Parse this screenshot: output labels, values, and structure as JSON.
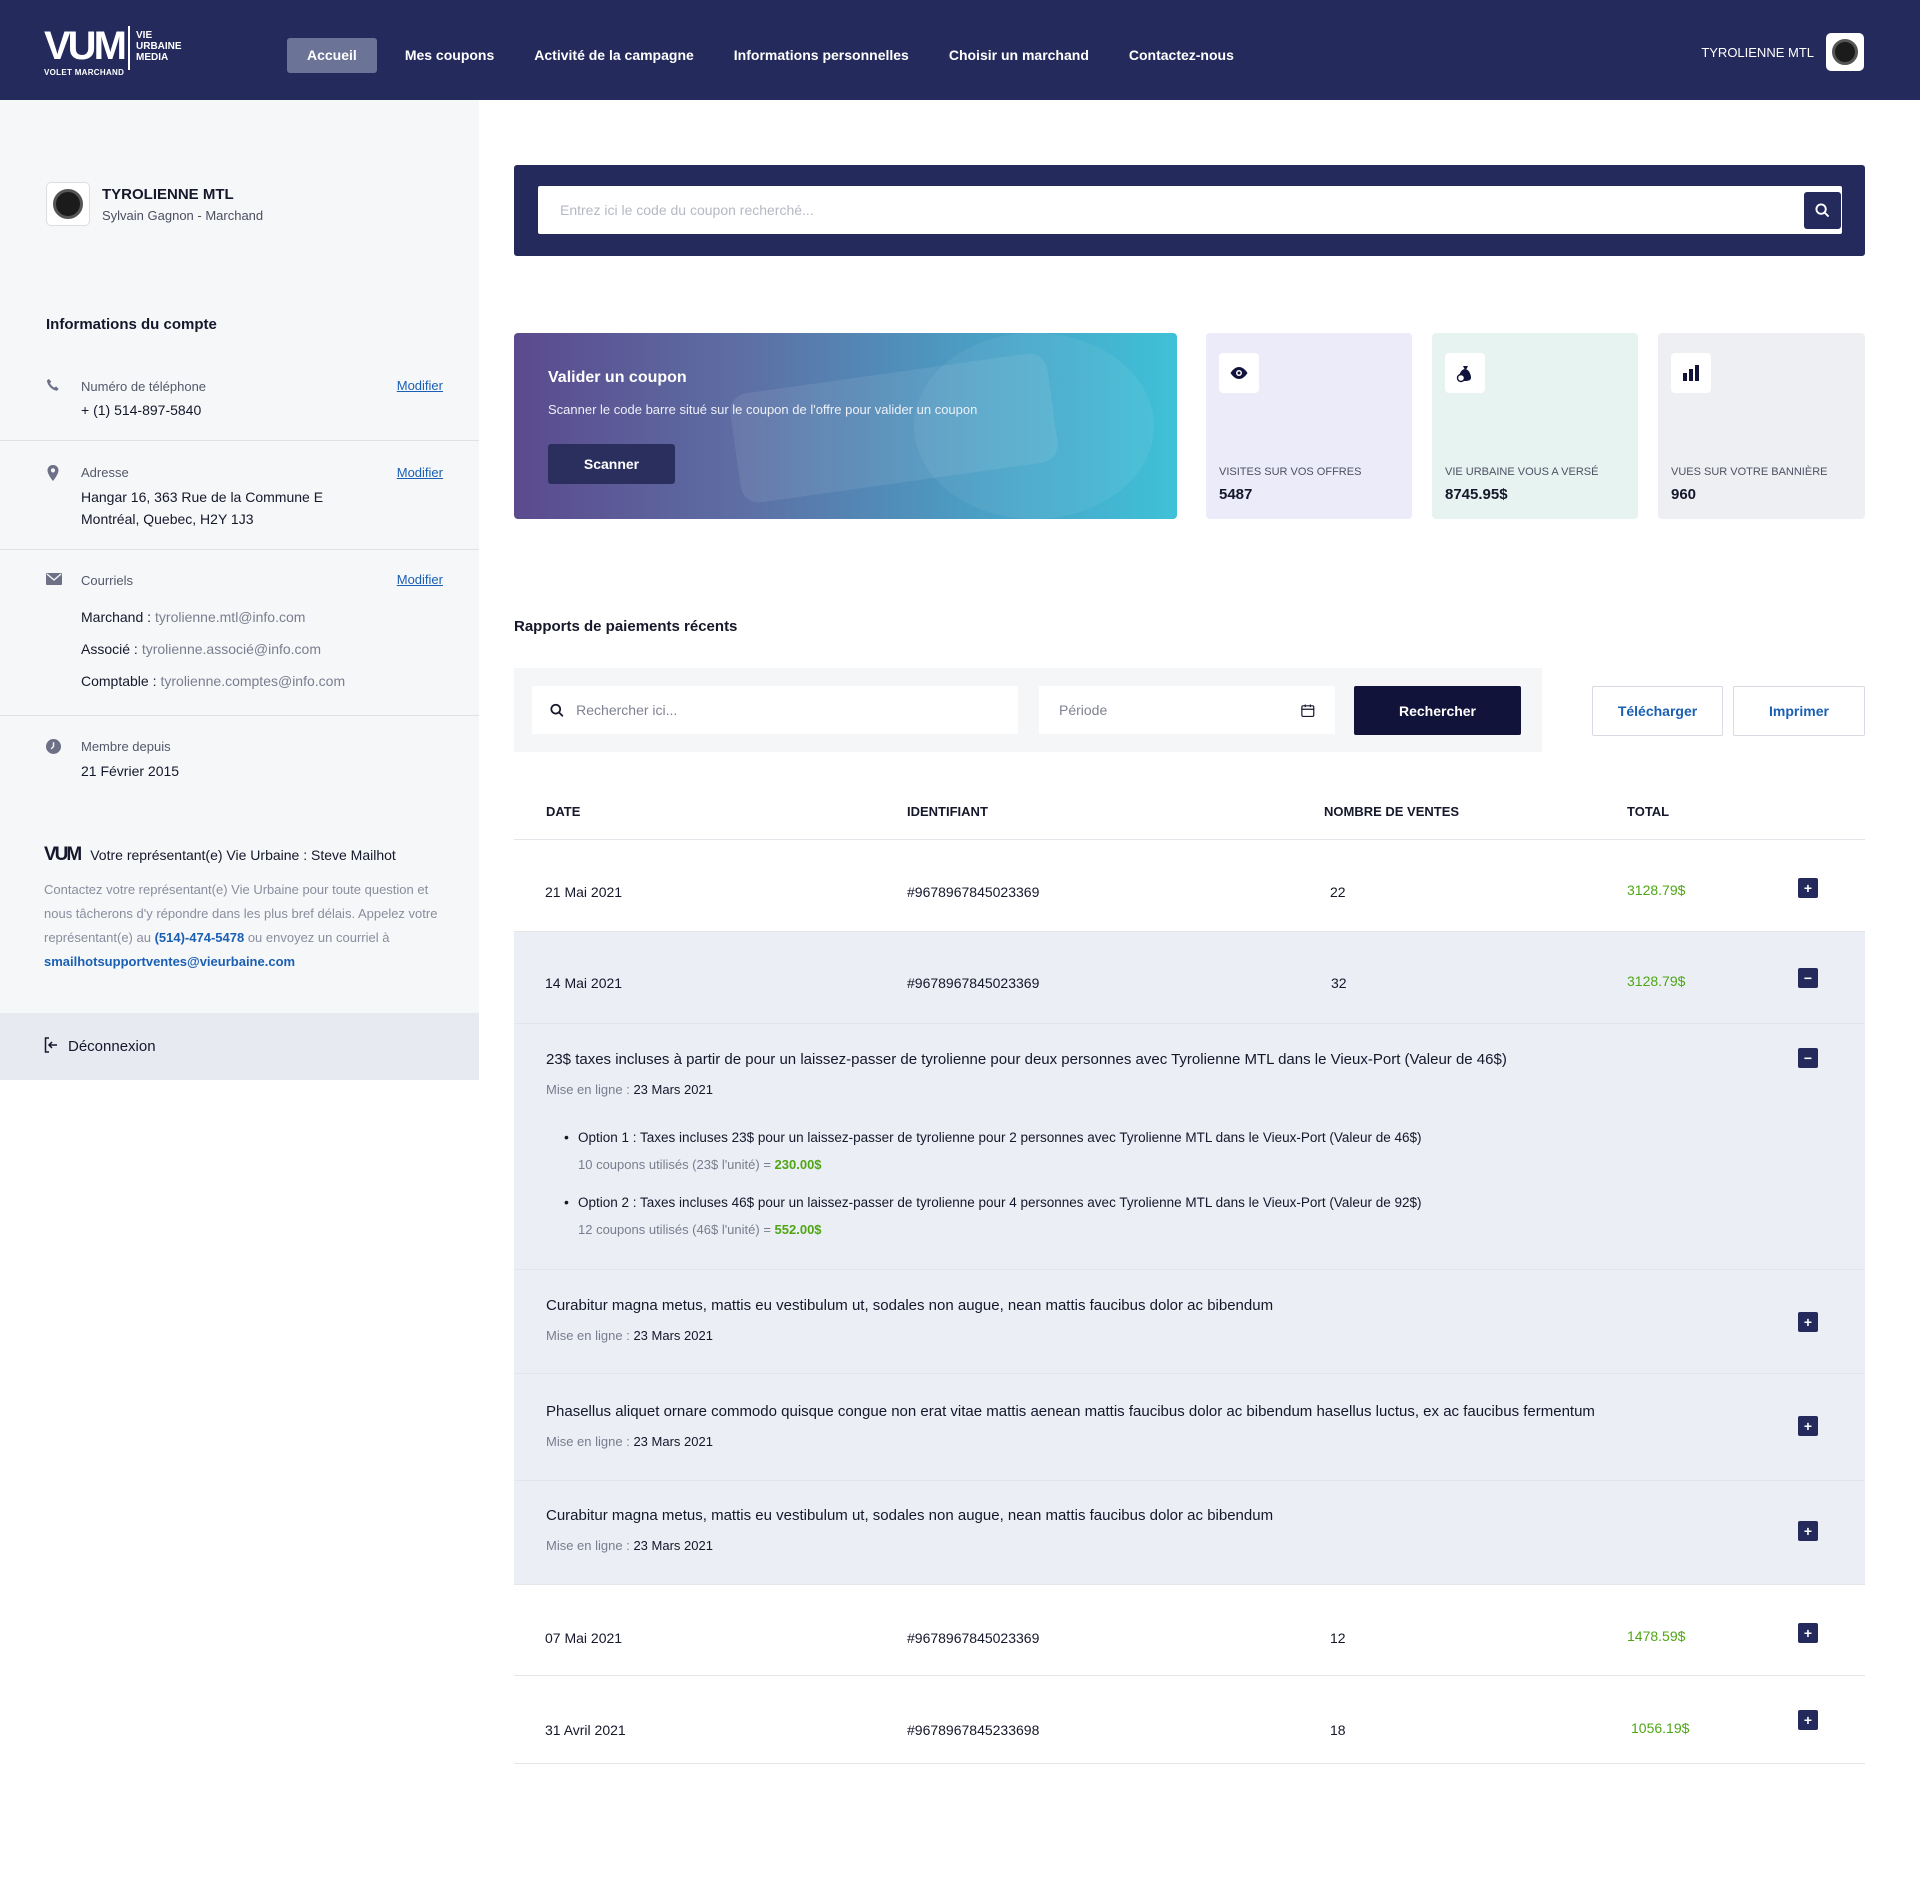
{
  "header": {
    "logo_mark": "VUM",
    "logo_words": [
      "VIE",
      "URBAINE",
      "MEDIA"
    ],
    "logo_sub": "VOLET MARCHAND",
    "nav": [
      "Accueil",
      "Mes coupons",
      "Activité de la campagne",
      "Informations personnelles",
      "Choisir un marchand",
      "Contactez-nous"
    ],
    "active_nav": "Accueil",
    "user_name": "TYROLIENNE MTL"
  },
  "sidebar": {
    "profile_name": "TYROLIENNE MTL",
    "profile_sub": "Sylvain Gagnon - Marchand",
    "account_title": "Informations du compte",
    "phone_label": "Numéro de téléphone",
    "phone_value": "+ (1) 514-897-5840",
    "address_label": "Adresse",
    "address_line1": "Hangar 16, 363 Rue de la Commune E",
    "address_line2": "Montréal, Quebec, H2Y 1J3",
    "emails_label": "Courriels",
    "emails": [
      {
        "k": "Marchand :",
        "v": "tyrolienne.mtl@info.com"
      },
      {
        "k": "Associé :",
        "v": "tyrolienne.associé@info.com"
      },
      {
        "k": "Comptable :",
        "v": "tyrolienne.comptes@info.com"
      }
    ],
    "modify_label": "Modifier",
    "member_label": "Membre depuis",
    "member_value": "21 Février 2015",
    "rep_logo": "VUM",
    "rep_title": "Votre représentant(e) Vie Urbaine : Steve Mailhot",
    "rep_text_1": "Contactez votre représentant(e) Vie Urbaine pour toute question et nous tâcherons d'y répondre dans les plus bref délais. Appelez votre représentant(e) au ",
    "rep_phone": "(514)-474-5478",
    "rep_text_2": " ou envoyez un courriel à ",
    "rep_email": "smailhotsupportventes@vieurbaine.com",
    "logout": "Déconnexion"
  },
  "search": {
    "placeholder": "Entrez ici le code du coupon recherché..."
  },
  "validate": {
    "title": "Valider un coupon",
    "subtitle": "Scanner le code barre situé sur le coupon de l'offre pour valider un coupon",
    "button": "Scanner"
  },
  "stats": [
    {
      "label": "VISITES SUR VOS OFFRES",
      "value": "5487",
      "icon": "eye-icon",
      "bg": "#ebebf9"
    },
    {
      "label": "VIE URBAINE VOUS A VERSÉ",
      "value": "8745.95$",
      "icon": "money-bag-icon",
      "bg": "#e6f3f0"
    },
    {
      "label": "VUES SUR VOTRE BANNIÈRE",
      "value": "960",
      "icon": "bar-chart-icon",
      "bg": "#eeeff3"
    }
  ],
  "reports": {
    "title": "Rapports de paiements récents",
    "search_placeholder": "Rechercher ici...",
    "period_placeholder": "Période",
    "search_btn": "Rechercher",
    "download_btn": "Télécharger",
    "print_btn": "Imprimer",
    "columns": [
      "DATE",
      "IDENTIFIANT",
      "NOMBRE DE VENTES",
      "TOTAL"
    ],
    "rows": [
      {
        "date": "21 Mai 2021",
        "id": "#9678967845023369",
        "sales": "22",
        "total": "3128.79$",
        "toggle": "+"
      },
      {
        "date": "14 Mai 2021",
        "id": "#9678967845023369",
        "sales": "32",
        "total": "3128.79$",
        "toggle": "−"
      },
      {
        "date": "07 Mai 2021",
        "id": "#9678967845023369",
        "sales": "12",
        "total": "1478.59$",
        "toggle": "+"
      },
      {
        "date": "31 Avril 2021",
        "id": "#9678967845233698",
        "sales": "18",
        "total": "1056.19$",
        "toggle": "+"
      }
    ],
    "online_label": "Mise en ligne :",
    "details": [
      {
        "title": "23$ taxes incluses à partir de pour un laissez-passer de tyrolienne pour deux personnes avec Tyrolienne MTL dans le Vieux-Port (Valeur de 46$)",
        "date": "23 Mars 2021",
        "toggle": "−",
        "options": [
          {
            "text": "Option 1 : Taxes incluses 23$ pour un laissez-passer de tyrolienne pour 2 personnes avec Tyrolienne MTL dans le Vieux-Port (Valeur de 46$)",
            "sub": "10 coupons utilisés (23$ l'unité) = ",
            "amount": "230.00$"
          },
          {
            "text": "Option 2 : Taxes incluses 46$ pour un laissez-passer de tyrolienne pour 4 personnes avec Tyrolienne MTL dans le Vieux-Port (Valeur de 92$)",
            "sub": "12 coupons utilisés (46$ l'unité) = ",
            "amount": "552.00$"
          }
        ]
      },
      {
        "title": "Curabitur magna metus, mattis eu vestibulum ut, sodales non augue, nean mattis faucibus dolor ac bibendum",
        "date": "23 Mars 2021",
        "toggle": "+"
      },
      {
        "title": "Phasellus aliquet ornare commodo quisque congue non erat vitae mattis aenean mattis faucibus dolor ac bibendum hasellus luctus, ex ac faucibus fermentum",
        "date": "23 Mars 2021",
        "toggle": "+"
      },
      {
        "title": "Curabitur magna metus, mattis eu vestibulum ut, sodales non augue, nean mattis faucibus dolor ac bibendum",
        "date": "23 Mars 2021",
        "toggle": "+"
      }
    ]
  },
  "colors": {
    "navy": "#242a5c",
    "dark_button": "#11133a",
    "link": "#1a5fb4",
    "amount_green": "#4fa615",
    "expanded_bg": "#ebeef4"
  }
}
